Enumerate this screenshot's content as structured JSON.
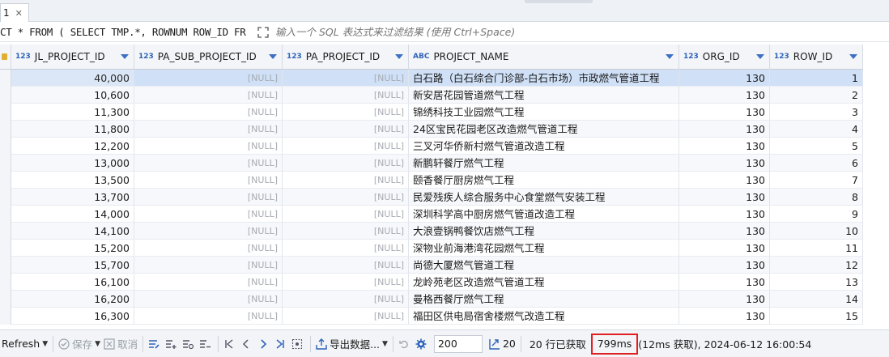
{
  "tab": {
    "label": "1"
  },
  "filter": {
    "query": "CT * FROM ( SELECT TMP.*, ROWNUM ROW_ID FR",
    "placeholder": "输入一个 SQL 表达式来过滤结果 (使用 Ctrl+Space)"
  },
  "columns": [
    {
      "type": "123",
      "name": "JL_PROJECT_ID"
    },
    {
      "type": "123",
      "name": "PA_SUB_PROJECT_ID"
    },
    {
      "type": "123",
      "name": "PA_PROJECT_ID"
    },
    {
      "type": "ABC",
      "name": "PROJECT_NAME"
    },
    {
      "type": "123",
      "name": "ORG_ID"
    },
    {
      "type": "123",
      "name": "ROW_ID"
    }
  ],
  "rows": [
    {
      "jl": "40,000",
      "sub": "[NULL]",
      "pa": "[NULL]",
      "name": "白石路（白石综合门诊部-白石市场）市政燃气管道工程",
      "org": "130",
      "rid": "1"
    },
    {
      "jl": "10,600",
      "sub": "[NULL]",
      "pa": "[NULL]",
      "name": "新安居花园管道燃气工程",
      "org": "130",
      "rid": "2"
    },
    {
      "jl": "11,300",
      "sub": "[NULL]",
      "pa": "[NULL]",
      "name": "锦绣科技工业园燃气工程",
      "org": "130",
      "rid": "3"
    },
    {
      "jl": "11,800",
      "sub": "[NULL]",
      "pa": "[NULL]",
      "name": "24区宝民花园老区改造燃气管道工程",
      "org": "130",
      "rid": "4"
    },
    {
      "jl": "12,200",
      "sub": "[NULL]",
      "pa": "[NULL]",
      "name": "三叉河华侨新村燃气管道改造工程",
      "org": "130",
      "rid": "5"
    },
    {
      "jl": "13,000",
      "sub": "[NULL]",
      "pa": "[NULL]",
      "name": "新鹏轩餐厅燃气工程",
      "org": "130",
      "rid": "6"
    },
    {
      "jl": "13,500",
      "sub": "[NULL]",
      "pa": "[NULL]",
      "name": "颐香餐厅厨房燃气工程",
      "org": "130",
      "rid": "7"
    },
    {
      "jl": "13,700",
      "sub": "[NULL]",
      "pa": "[NULL]",
      "name": "民爱残疾人综合服务中心食堂燃气安装工程",
      "org": "130",
      "rid": "8"
    },
    {
      "jl": "14,000",
      "sub": "[NULL]",
      "pa": "[NULL]",
      "name": "深圳科学高中厨房燃气管道改造工程",
      "org": "130",
      "rid": "9"
    },
    {
      "jl": "14,100",
      "sub": "[NULL]",
      "pa": "[NULL]",
      "name": "大浪壹锅鸭餐饮店燃气工程",
      "org": "130",
      "rid": "10"
    },
    {
      "jl": "15,200",
      "sub": "[NULL]",
      "pa": "[NULL]",
      "name": "深物业前海港湾花园燃气工程",
      "org": "130",
      "rid": "11"
    },
    {
      "jl": "15,700",
      "sub": "[NULL]",
      "pa": "[NULL]",
      "name": "尚德大厦燃气管道工程",
      "org": "130",
      "rid": "12"
    },
    {
      "jl": "16,100",
      "sub": "[NULL]",
      "pa": "[NULL]",
      "name": "龙岭苑老区改造燃气管道工程",
      "org": "130",
      "rid": "13"
    },
    {
      "jl": "16,200",
      "sub": "[NULL]",
      "pa": "[NULL]",
      "name": "曼格西餐厅燃气工程",
      "org": "130",
      "rid": "14"
    },
    {
      "jl": "16,300",
      "sub": "[NULL]",
      "pa": "[NULL]",
      "name": "福田区供电局宿舍楼燃气改造工程",
      "org": "130",
      "rid": "15"
    }
  ],
  "toolbar": {
    "refresh": "Refresh",
    "save": "保存",
    "cancel": "取消",
    "export": "导出数据...",
    "fetch_size": "200",
    "fetch_count": "20",
    "rows_fetched": "20 行已获取",
    "exec_time": "799ms",
    "fetch_info": "(12ms 获取), 2024-06-12 16:00:54"
  }
}
